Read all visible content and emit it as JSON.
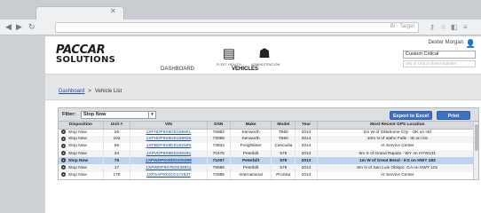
{
  "browser": {
    "url_text": "Bi - Target"
  },
  "header": {
    "logo_line1": "PACCAR",
    "logo_line2": "SOLUTIONS",
    "icons": [
      {
        "caption": "FLEET HEALTH"
      },
      {
        "caption": "ADMINISTRATION"
      }
    ],
    "user_name": "Dexter Morgan",
    "select_value": "Custom Critical",
    "search_placeholder": "VIN or Unit or Event Number"
  },
  "topnav": {
    "dashboard": "DASHBOARD",
    "vehicles": "VEHICLES"
  },
  "breadcrumb": {
    "home": "Dashboard",
    "separator": ">",
    "current": "Vehicle List"
  },
  "filterbar": {
    "label": "Filter:",
    "value": "Stop Now",
    "export_label": "Export to Excel",
    "print_label": "Print"
  },
  "table": {
    "columns": [
      "Disposition",
      "Unit #",
      "VIN",
      "DSN",
      "Make",
      "Model",
      "Year",
      "Most Recent GPS Location"
    ],
    "rows": [
      [
        "Stop Now",
        "26",
        "1XPHDP9X8DD189851",
        "76982",
        "Kenworth",
        "T660",
        "2013",
        "2m W of Oklahome City - OK on I40"
      ],
      [
        "Stop Now",
        "102",
        "1XPHDP9X8DD169928",
        "73068",
        "Kenworth",
        "T660",
        "2014",
        "10m N of Idaho Falls - ID on I15"
      ],
      [
        "Stop Now",
        "56",
        "1XPBDP9X8DD192589",
        "73834",
        "Freightliner",
        "Cascadia",
        "2014",
        "At Service Center"
      ],
      [
        "Stop Now",
        "34",
        "1XPVDP9X8ED228192",
        "70476",
        "Peterbilt",
        "579",
        "2013",
        "8m S of Grand Rapids - WY on HYW131"
      ],
      [
        "Stop Now",
        "75",
        "1XPWDP9X8DD205288",
        "71007",
        "Peterbilt",
        "579",
        "2013",
        "1m W of Great Bend - KS on HWY 183"
      ],
      [
        "Stop Now",
        "17",
        "1XPWDP9X7ED236811",
        "79596",
        "Peterbilt",
        "579",
        "2014",
        "8m N of San Luis Obispo -CA on HWY 101"
      ],
      [
        "Stop Now",
        "179",
        "1XP4AP9X4CD172847",
        "72985",
        "International",
        "ProStar",
        "2013",
        "At Service Center"
      ]
    ],
    "selected_row_index": 4
  }
}
